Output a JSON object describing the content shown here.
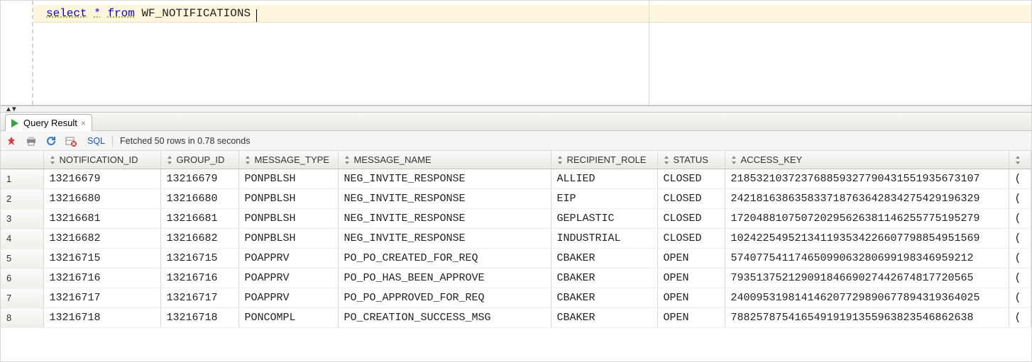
{
  "editor": {
    "sql_tokens": [
      "select",
      "*",
      "from",
      "WF_NOTIFICATIONS"
    ]
  },
  "split_glyph": "▲▼",
  "tab": {
    "label": "Query Result",
    "close_glyph": "×"
  },
  "toolbar": {
    "sql_label": "SQL",
    "status": "Fetched 50 rows in 0.78 seconds"
  },
  "grid": {
    "columns": [
      "NOTIFICATION_ID",
      "GROUP_ID",
      "MESSAGE_TYPE",
      "MESSAGE_NAME",
      "RECIPIENT_ROLE",
      "STATUS",
      "ACCESS_KEY"
    ],
    "rows": [
      {
        "n": "1",
        "NOTIFICATION_ID": "13216679",
        "GROUP_ID": "13216679",
        "MESSAGE_TYPE": "PONPBLSH",
        "MESSAGE_NAME": "NEG_INVITE_RESPONSE",
        "RECIPIENT_ROLE": "ALLIED",
        "STATUS": "CLOSED",
        "ACCESS_KEY": "218532103723768859327790431551935673107"
      },
      {
        "n": "2",
        "NOTIFICATION_ID": "13216680",
        "GROUP_ID": "13216680",
        "MESSAGE_TYPE": "PONPBLSH",
        "MESSAGE_NAME": "NEG_INVITE_RESPONSE",
        "RECIPIENT_ROLE": "EIP",
        "STATUS": "CLOSED",
        "ACCESS_KEY": "242181638635833718763642834275429196329"
      },
      {
        "n": "3",
        "NOTIFICATION_ID": "13216681",
        "GROUP_ID": "13216681",
        "MESSAGE_TYPE": "PONPBLSH",
        "MESSAGE_NAME": "NEG_INVITE_RESPONSE",
        "RECIPIENT_ROLE": "GEPLASTIC",
        "STATUS": "CLOSED",
        "ACCESS_KEY": "172048810750720295626381146255775195279"
      },
      {
        "n": "4",
        "NOTIFICATION_ID": "13216682",
        "GROUP_ID": "13216682",
        "MESSAGE_TYPE": "PONPBLSH",
        "MESSAGE_NAME": "NEG_INVITE_RESPONSE",
        "RECIPIENT_ROLE": "INDUSTRIAL",
        "STATUS": "CLOSED",
        "ACCESS_KEY": "102422549521341193534226607798854951569"
      },
      {
        "n": "5",
        "NOTIFICATION_ID": "13216715",
        "GROUP_ID": "13216715",
        "MESSAGE_TYPE": "POAPPRV",
        "MESSAGE_NAME": "PO_PO_CREATED_FOR_REQ",
        "RECIPIENT_ROLE": "CBAKER",
        "STATUS": "OPEN",
        "ACCESS_KEY": "57407754117465099063280699198346959212"
      },
      {
        "n": "6",
        "NOTIFICATION_ID": "13216716",
        "GROUP_ID": "13216716",
        "MESSAGE_TYPE": "POAPPRV",
        "MESSAGE_NAME": "PO_PO_HAS_BEEN_APPROVE",
        "RECIPIENT_ROLE": "CBAKER",
        "STATUS": "OPEN",
        "ACCESS_KEY": "79351375212909184669027442674817720565"
      },
      {
        "n": "7",
        "NOTIFICATION_ID": "13216717",
        "GROUP_ID": "13216717",
        "MESSAGE_TYPE": "POAPPRV",
        "MESSAGE_NAME": "PO_PO_APPROVED_FOR_REQ",
        "RECIPIENT_ROLE": "CBAKER",
        "STATUS": "OPEN",
        "ACCESS_KEY": "240095319814146207729890677894319364025"
      },
      {
        "n": "8",
        "NOTIFICATION_ID": "13216718",
        "GROUP_ID": "13216718",
        "MESSAGE_TYPE": "PONCOMPL",
        "MESSAGE_NAME": "PO_CREATION_SUCCESS_MSG",
        "RECIPIENT_ROLE": "CBAKER",
        "STATUS": "OPEN",
        "ACCESS_KEY": "78825787541654919191355963823546862638"
      }
    ]
  }
}
